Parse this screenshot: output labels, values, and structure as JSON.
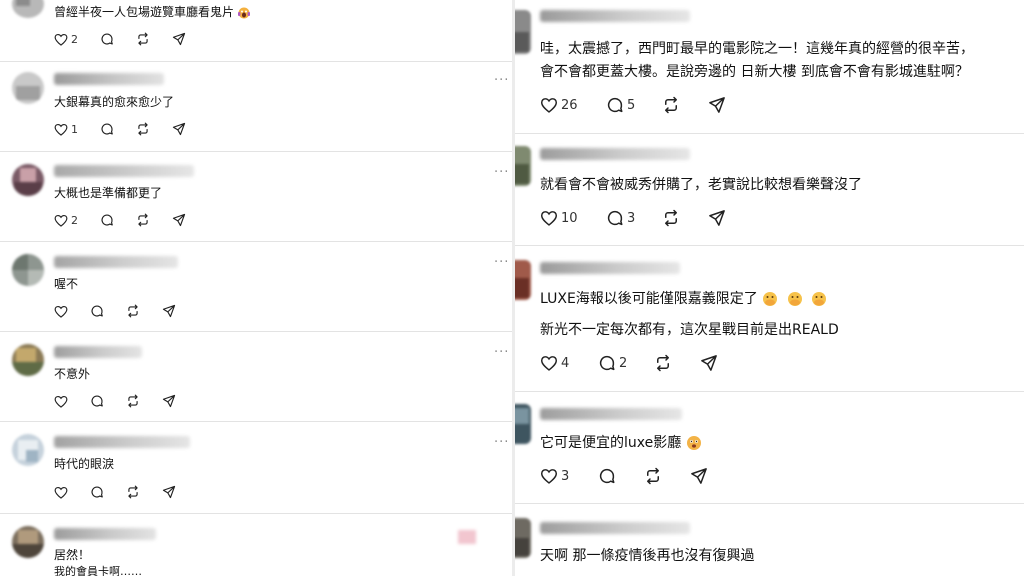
{
  "left_panel": {
    "posts": [
      {
        "text": "曾經半夜一人包場遊覽車廳看鬼片",
        "likes": "2",
        "replies": "",
        "reposts": ""
      },
      {
        "text": "大銀幕真的愈來愈少了",
        "likes": "1",
        "replies": "",
        "reposts": ""
      },
      {
        "text": "大概也是準備都更了",
        "likes": "2",
        "replies": "",
        "reposts": ""
      },
      {
        "text": "喔不",
        "likes": "",
        "replies": "",
        "reposts": ""
      },
      {
        "text": "不意外",
        "likes": "",
        "replies": "",
        "reposts": ""
      },
      {
        "text": "時代的眼淚",
        "likes": "",
        "replies": "",
        "reposts": ""
      },
      {
        "text": "居然！",
        "text2": "我的會員卡啊……"
      }
    ]
  },
  "right_panel": {
    "posts": [
      {
        "text": "哇，太震撼了，西門町最早的電影院之一！這幾年真的經營的很辛苦，",
        "text2": "會不會都更蓋大樓。是說旁邊的 日新大樓 到底會不會有影城進駐啊？",
        "likes": "26",
        "replies": "5",
        "reposts": ""
      },
      {
        "text": "就看會不會被威秀併購了，老實說比較想看樂聲沒了",
        "likes": "10",
        "replies": "3",
        "reposts": ""
      },
      {
        "text": "LUXE海報以後可能僅限嘉義限定了",
        "text2": "新光不一定每次都有，這次星戰目前是出REALD",
        "likes": "4",
        "replies": "2",
        "reposts": ""
      },
      {
        "text": "它可是便宜的luxe影廳",
        "likes": "3",
        "replies": "",
        "reposts": ""
      },
      {
        "text": "天啊 那一條疫情後再也沒有復興過"
      }
    ]
  },
  "icons": {
    "like": "heart-icon",
    "reply": "comment-icon",
    "repost": "repost-icon",
    "share": "send-icon",
    "more": "more-options-icon",
    "emoji_scream": "screaming-face-emoji",
    "emoji_hand": "hand-over-mouth-emoji",
    "emoji_wow": "astonished-face-emoji"
  },
  "colors": {
    "text": "#111111",
    "divider": "#e3e3e3",
    "icon": "#222222",
    "meta": "#888888"
  }
}
